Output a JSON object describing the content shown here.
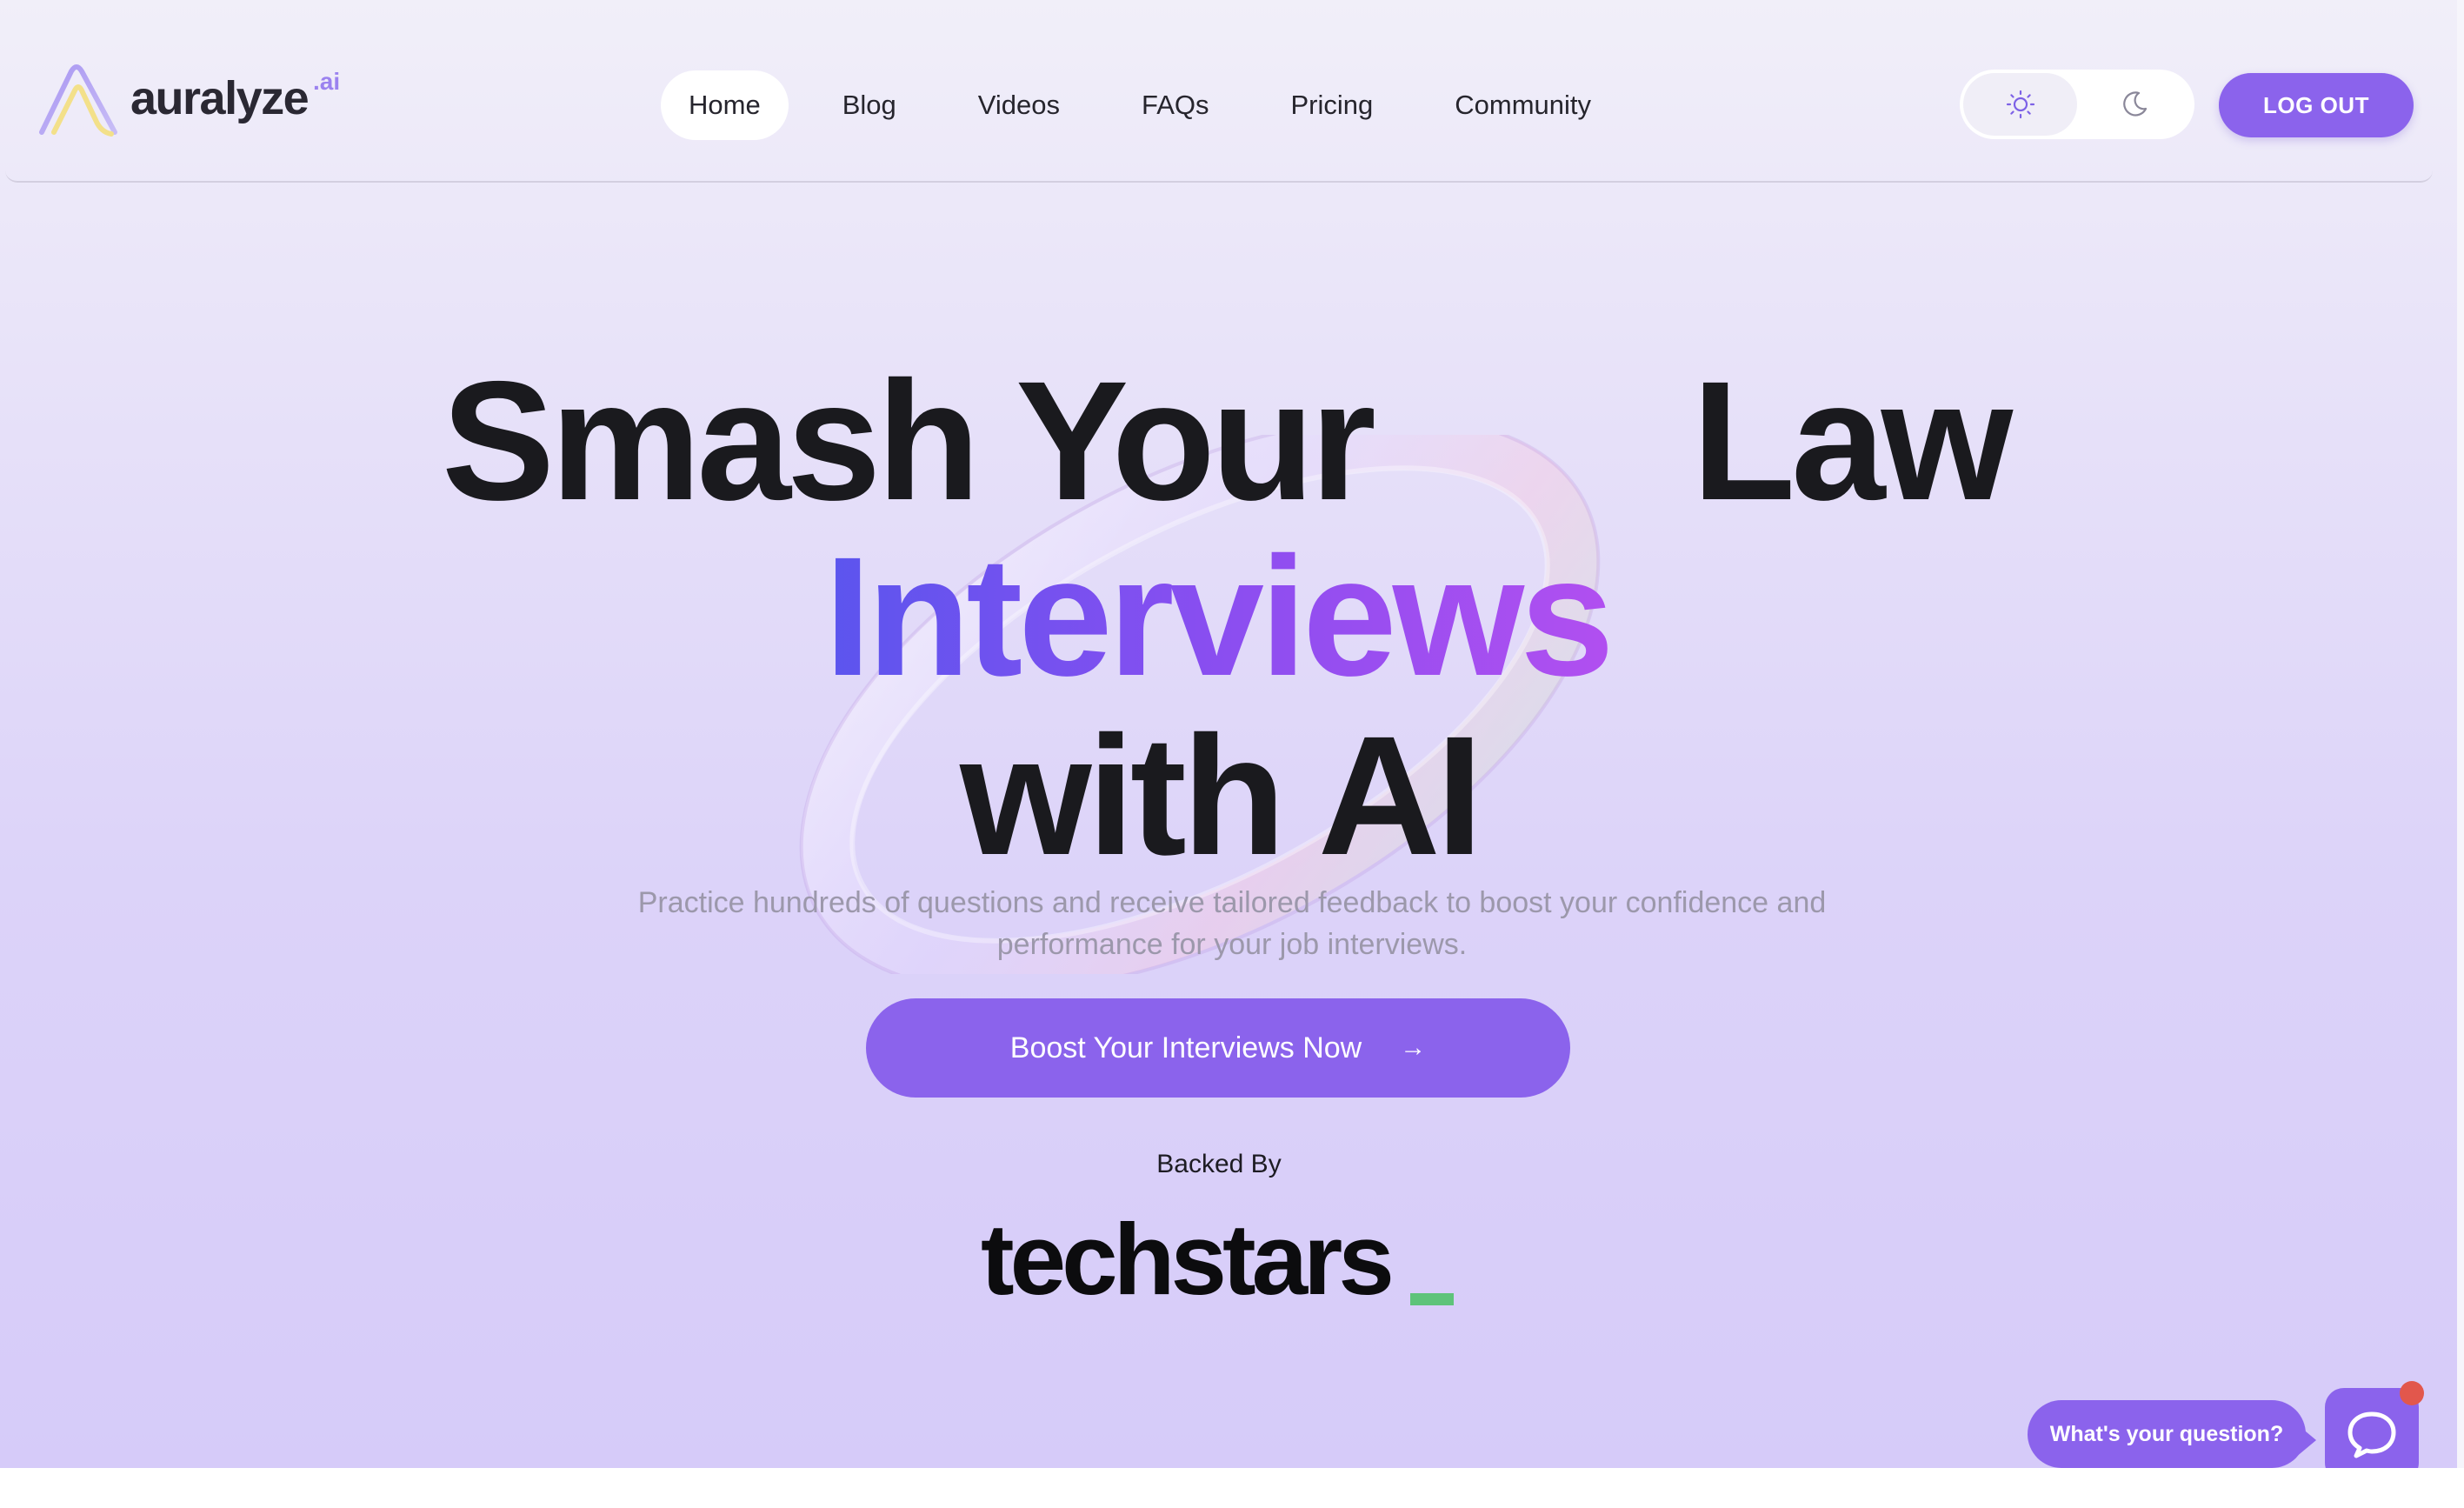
{
  "brand": {
    "name": "auralyze",
    "suffix": ".ai",
    "colors": {
      "primary": "#8b63ec",
      "gradient_start": "#5b55ee",
      "gradient_end": "#b14ff0"
    }
  },
  "nav": {
    "items": [
      {
        "label": "Home",
        "active": true
      },
      {
        "label": "Blog",
        "active": false
      },
      {
        "label": "Videos",
        "active": false
      },
      {
        "label": "FAQs",
        "active": false
      },
      {
        "label": "Pricing",
        "active": false
      },
      {
        "label": "Community",
        "active": false
      }
    ]
  },
  "theme_toggle": {
    "options": [
      "sun-icon",
      "moon-icon"
    ],
    "selected": "light"
  },
  "header": {
    "logout_label": "LOG OUT"
  },
  "hero": {
    "line1_a": "Smash Your",
    "line1_b": "Law",
    "line2": "Interviews",
    "line3": "with AI",
    "subtitle": "Practice hundreds of questions and receive tailored feedback to boost your confidence and performance for your job interviews.",
    "cta_label": "Boost Your Interviews Now",
    "cta_icon": "arrow-right-icon"
  },
  "backed": {
    "label": "Backed By",
    "partner": "techstars"
  },
  "chat": {
    "prompt": "What's your question?",
    "icon": "chat-icon",
    "notification": true
  }
}
